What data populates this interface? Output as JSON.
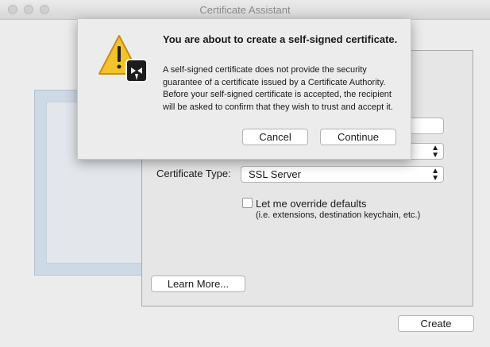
{
  "window": {
    "title": "Certificate Assistant"
  },
  "form": {
    "certificate_type_label": "Certificate Type:",
    "certificate_type_value": "SSL Server",
    "override_label": "Let me override defaults",
    "override_hint": "(i.e. extensions, destination keychain, etc.)",
    "override_checked": false
  },
  "buttons": {
    "learn_more": "Learn More...",
    "create": "Create"
  },
  "alert": {
    "title": "You are about to create a self-signed certificate.",
    "message": "A self-signed certificate does not provide the security guarantee of a certificate issued by a Certificate Authority. Before your self-signed certificate is accepted, the recipient will be asked to confirm that they wish to trust and accept it.",
    "cancel": "Cancel",
    "continue": "Continue",
    "icon": "caution-icon"
  }
}
